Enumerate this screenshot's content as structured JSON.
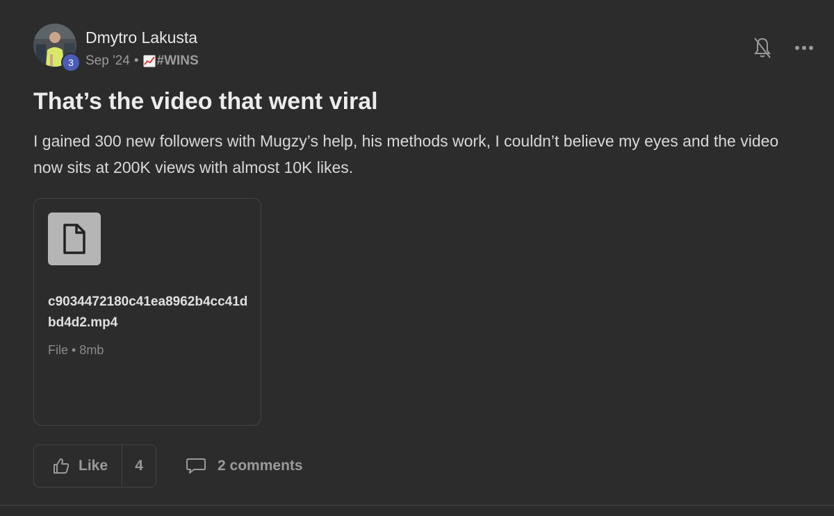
{
  "post": {
    "author": "Dmytro Lakusta",
    "level": "3",
    "date": "Sep '24",
    "separator": "•",
    "category_emoji": "chart-increasing-icon",
    "category": "#WINS",
    "title": "That’s the video that went viral",
    "body": "I gained 300 new followers with Mugzy’s help, his methods work, I couldn’t believe my eyes and the video now sits at 200K views with almost 10K likes."
  },
  "attachment": {
    "icon": "file-icon",
    "filename": "c9034472180c41ea8962b4cc41dbd4d2.mp4",
    "meta": "File • 8mb"
  },
  "actions": {
    "like_label": "Like",
    "like_count": "4",
    "comments_label": "2 comments"
  },
  "top_actions": {
    "notification_icon": "bell-off-icon",
    "more_icon": "more-horizontal-icon"
  },
  "colors": {
    "background": "#2c2c2c",
    "level_badge": "#4a5bb8",
    "file_icon_bg": "#b5b5b5"
  }
}
